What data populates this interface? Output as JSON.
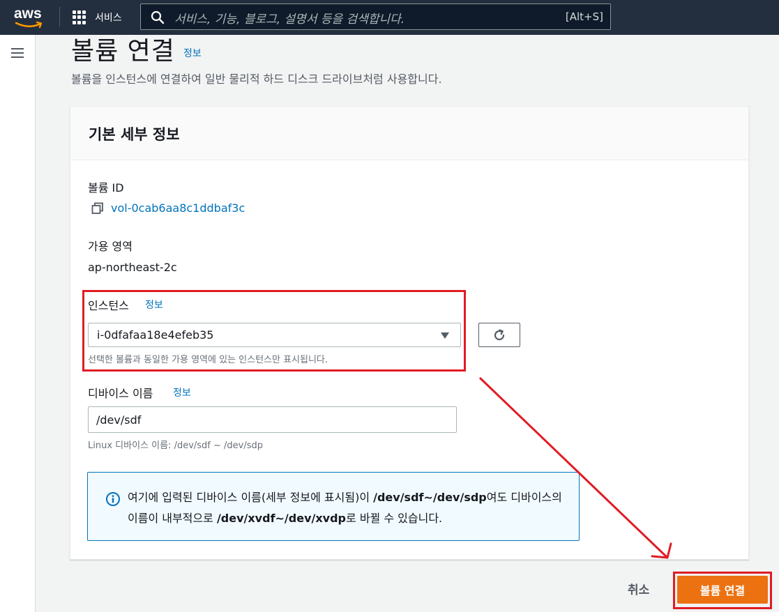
{
  "nav": {
    "logo_text": "aws",
    "services_label": "서비스",
    "search_placeholder": "서비스, 기능, 블로그, 설명서 등을 검색합니다.",
    "search_shortcut": "[Alt+S]"
  },
  "header": {
    "title": "볼륨 연결",
    "info": "정보",
    "description": "볼륨을 인스턴스에 연결하여 일반 물리적 하드 디스크 드라이브처럼 사용합니다."
  },
  "section": {
    "title": "기본 세부 정보",
    "volume_id_label": "볼륨 ID",
    "volume_id_value": "vol-0cab6aa8c1ddbaf3c",
    "az_label": "가용 영역",
    "az_value": "ap-northeast-2c",
    "instance_label": "인스턴스",
    "instance_info": "정보",
    "instance_value": "i-0dfafaa18e4efeb35",
    "instance_hint": "선택한 볼륨과 동일한 가용 영역에 있는 인스턴스만 표시됩니다.",
    "device_label": "디바이스 이름",
    "device_info": "정보",
    "device_value": "/dev/sdf",
    "device_hint": "Linux 디바이스 이름: /dev/sdf ~ /dev/sdp"
  },
  "alert": {
    "part1": "여기에 입력된 디바이스 이름(세부 정보에 표시됨)이 ",
    "bold1": "/dev/sdf~/dev/sdp",
    "part2": "여도 디바이스의 이름이 내부적으로 ",
    "bold2": "/dev/xvdf~/dev/xvdp",
    "part3": "로 바뀔 수 있습니다."
  },
  "actions": {
    "cancel": "취소",
    "submit": "볼륨 연결"
  },
  "colors": {
    "nav_bg": "#232f3e",
    "link": "#0073bb",
    "primary": "#ec7211",
    "annotation": "#e01c24"
  }
}
